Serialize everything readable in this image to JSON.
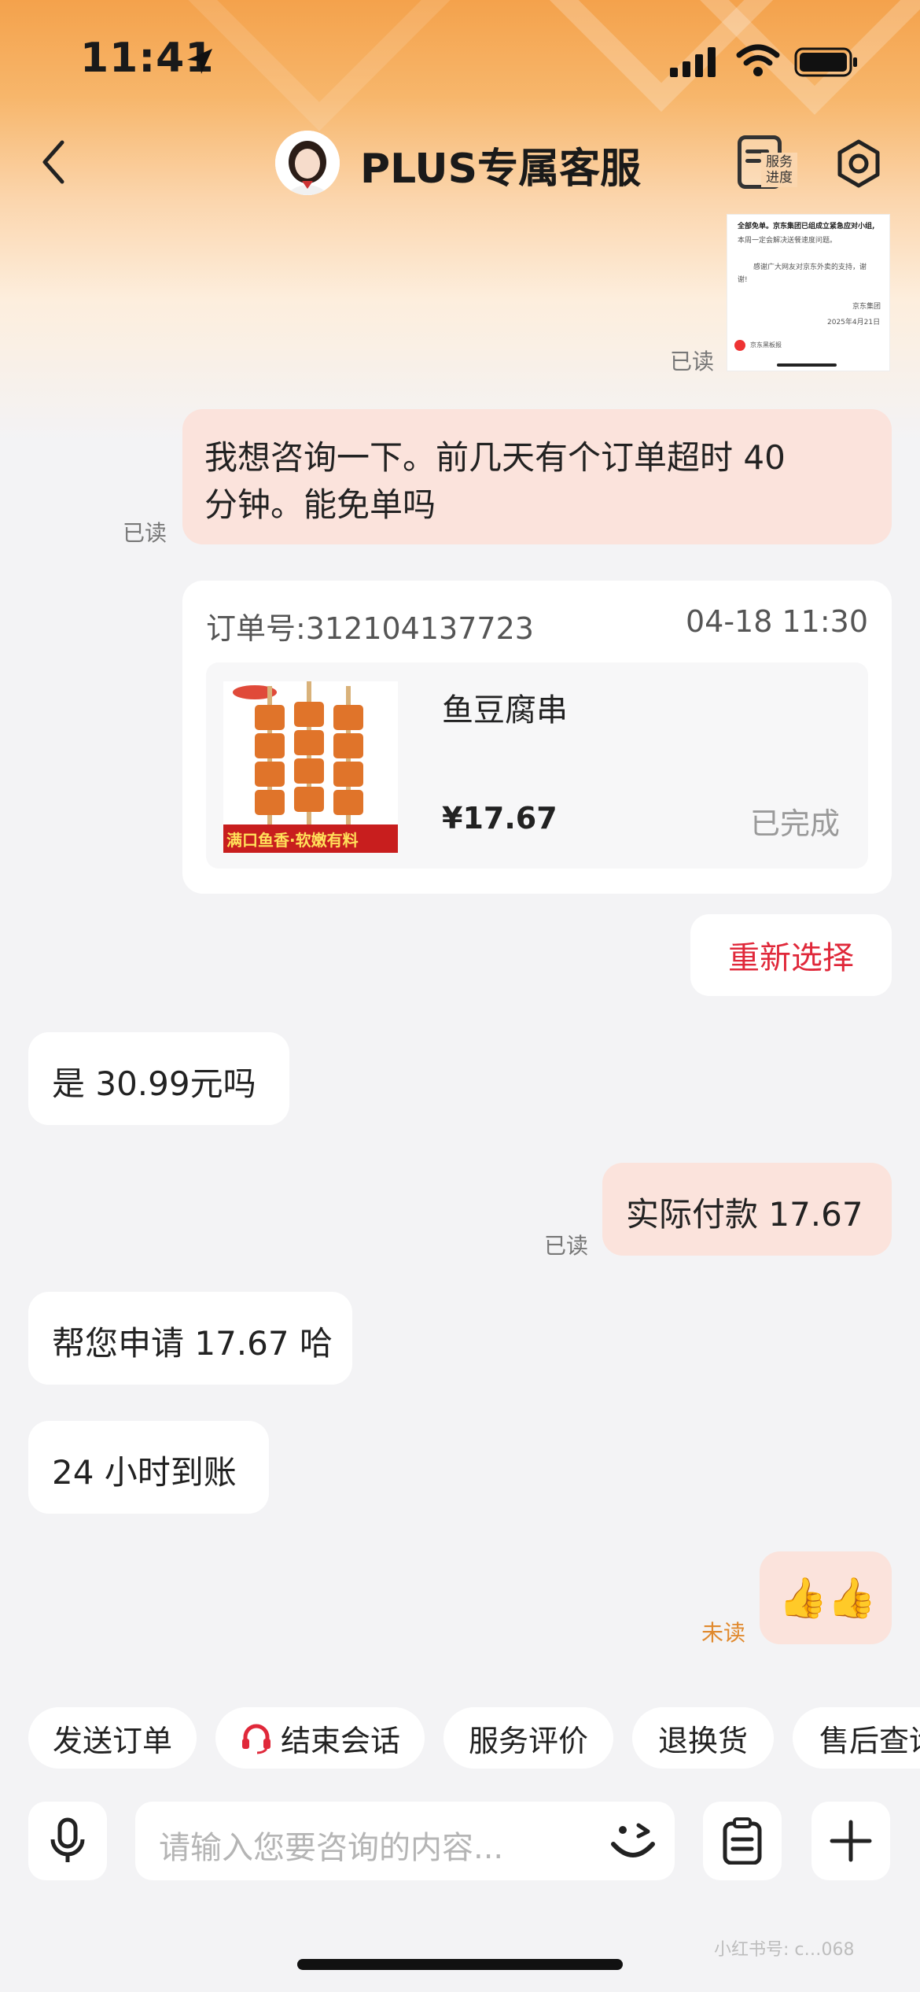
{
  "status_bar": {
    "time": "11:41"
  },
  "header": {
    "title": "PLUS专属客服",
    "service_label": "服务进度"
  },
  "messages": {
    "m1_read": "已读",
    "m2_text_line1": "我想咨询一下。前几天有个订单超时 40",
    "m2_text_line2": "分钟。能免单吗",
    "m2_read": "已读",
    "order": {
      "order_no": "订单号:312104137723",
      "time": "04-18 11:30",
      "product_name": "鱼豆腐串",
      "price": "¥17.67",
      "status": "已完成",
      "image_label": "满口鱼香·软嫩有料"
    },
    "reselect": "重新选择",
    "m3_text": "是 30.99元吗",
    "m4_text": "实际付款 17.67",
    "m4_read": "已读",
    "m5_text": "帮您申请 17.67 哈",
    "m6_text": "24 小时到账",
    "m7_emoji": "👍👍",
    "m7_status": "未读"
  },
  "thumb_text": {
    "line1": "全部免单。京东集团已组成立紧急应对小组,",
    "line2": "本周一定会解决送餐速度问题。",
    "line3": "感谢广大网友对京东外卖的支持，谢",
    "line4": "谢!",
    "sign": "京东集团",
    "date": "2025年4月21日",
    "account": "京东黑板报"
  },
  "quick_actions": [
    "发送订单",
    "结束会话",
    "服务评价",
    "退换货",
    "售后查询"
  ],
  "input": {
    "placeholder": "请输入您要咨询的内容..."
  },
  "watermark": "小红书号: c…068",
  "colors": {
    "accent_red": "#e0283a",
    "bubble_me": "#fbe3dc",
    "unread": "#e0892d"
  }
}
